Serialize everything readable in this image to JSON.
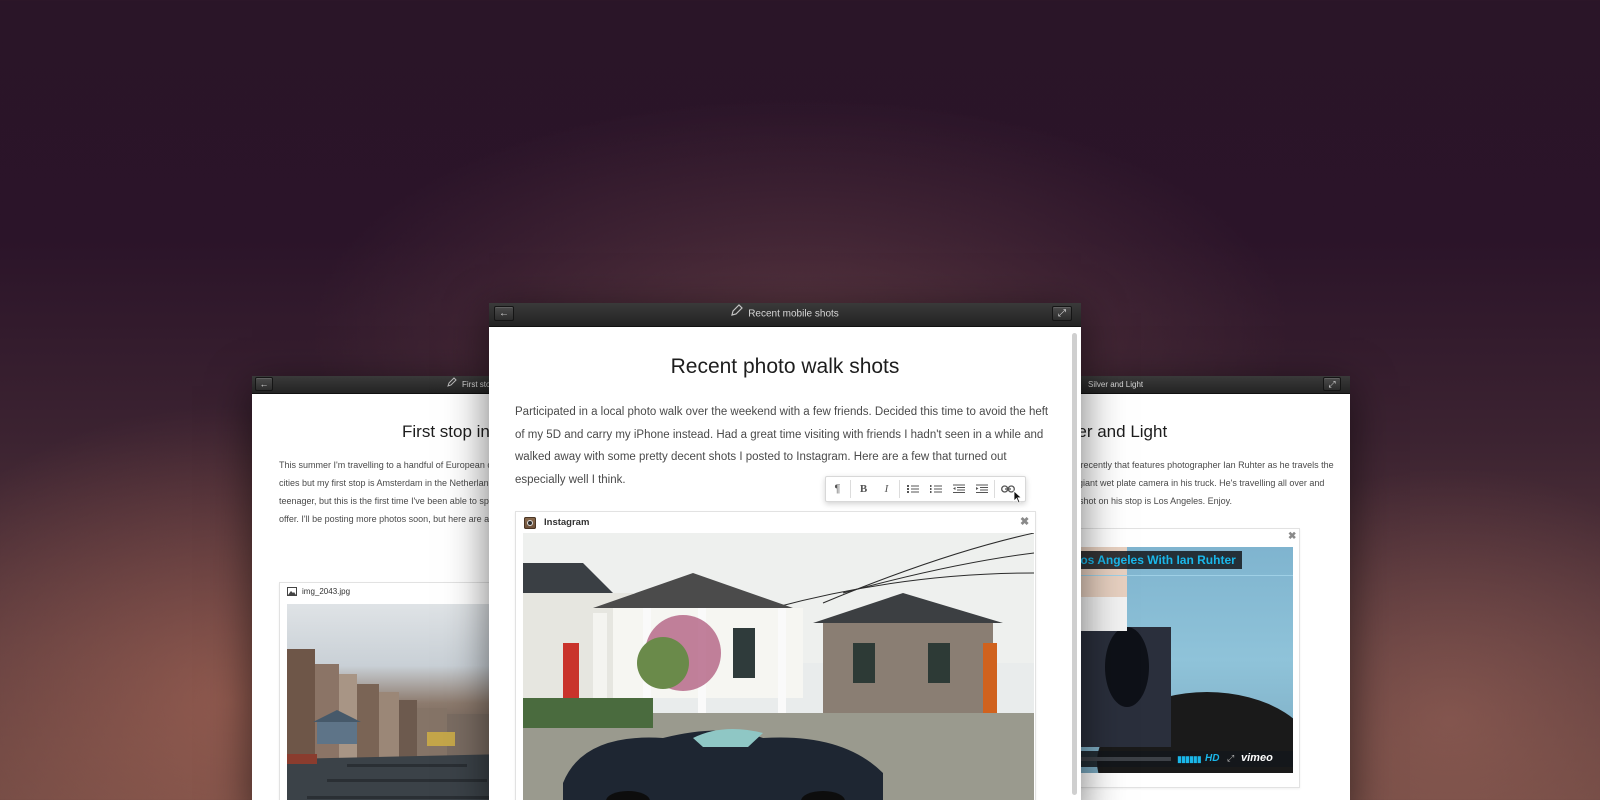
{
  "center": {
    "window_title": "Recent mobile shots",
    "doc_title": "Recent photo walk shots",
    "paragraph": "Participated in a local photo walk over the weekend with a few friends. Decided this time to avoid the heft of my 5D and carry my iPhone instead. Had a great time visiting with friends I hadn't seen in a while and walked away with some pretty decent shots I posted to Instagram. Here are a few that turned out especially well I think.",
    "embed_label": "Instagram",
    "embed_close": "✖"
  },
  "left": {
    "window_title": "First stop in Amsterdam",
    "doc_title": "First stop in Amsterdam",
    "paragraph": "This summer I'm travelling to a handful of European cities. I'll eventually make my way through various cities but my first stop is Amsterdam in the Netherlands. I only went there once as a backpack carrying teenager, but this is the first time I've been able to spend real time exploring everything the city has to offer. I'll be posting more photos soon, but here are a few of my most recent favorites.",
    "embed_label": "img_2043.jpg"
  },
  "right": {
    "window_title": "Silver and Light",
    "doc_title": "Silver and Light",
    "paragraph": "Saw this video recently that features photographer Ian Ruhter as he travels the country with a giant wet plate camera in his truck. He's travelling all over and this video was shot on his stop is Los Angeles. Enjoy.",
    "video_title": "Los Angeles With Ian Ruhter",
    "hd_label": "HD",
    "vimeo_label": "vimeo",
    "embed_close": "✖"
  },
  "toolbar": {
    "paragraph_btn": "¶",
    "bold_btn": "B",
    "italic_btn": "I"
  },
  "colors": {
    "vimeo_blue": "#1ab7ea",
    "titlebar_dark": "#2a2a2a"
  }
}
